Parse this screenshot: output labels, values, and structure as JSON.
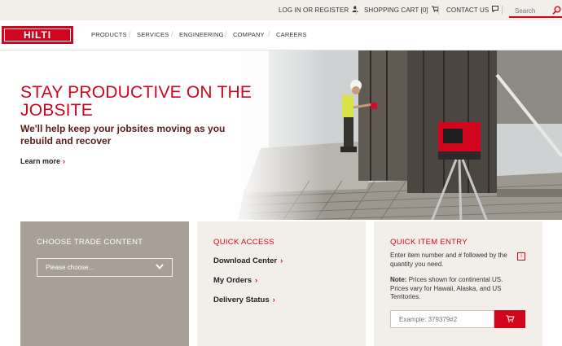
{
  "topbar": {
    "login_label": "LOG IN OR REGISTER",
    "cart_label": "SHOPPING CART [0]",
    "contact_label": "CONTACT US",
    "search_placeholder": "Search"
  },
  "brand": {
    "logo_text": "HILTI",
    "accent_color": "#d2051e"
  },
  "nav": {
    "items": [
      "PRODUCTS",
      "SERVICES",
      "ENGINEERING",
      "COMPANY",
      "CAREERS"
    ]
  },
  "hero": {
    "title": "STAY PRODUCTIVE ON THE JOBSITE",
    "subtitle": "We'll help keep your jobsites moving as you rebuild and recover",
    "link_label": "Learn more"
  },
  "trade": {
    "title": "CHOOSE TRADE CONTENT",
    "select_value": "Please choose..."
  },
  "quick_access": {
    "title": "QUICK ACCESS",
    "links": [
      "Download Center",
      "My Orders",
      "Delivery Status"
    ]
  },
  "quick_entry": {
    "title": "QUICK ITEM ENTRY",
    "instruction": "Enter item number and # followed by the quantity you need.",
    "note_label": "Note:",
    "note_text": "Prices shown for continental US. Prices vary for Hawaii, Alaska, and US Territories.",
    "input_placeholder": "Example: 379379#2"
  },
  "icons": {
    "login": "user-icon",
    "cart": "cart-icon",
    "contact": "chat-icon",
    "search": "search-icon",
    "entry_button": "cart-add-icon",
    "info": "info-icon"
  }
}
